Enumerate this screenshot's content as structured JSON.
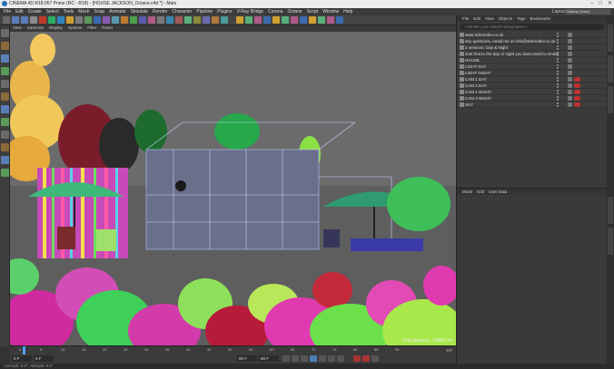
{
  "window": {
    "title": "CINEMA 4D R18.057 Prime (RC - R18) - [HOUSE JACKSON_Octane.c4d *] - Main",
    "controls": [
      "–",
      "□",
      "✕"
    ]
  },
  "menu": {
    "items": [
      "File",
      "Edit",
      "Create",
      "Select",
      "Tools",
      "Mesh",
      "Snap",
      "Animate",
      "Simulate",
      "Render",
      "Character",
      "Pipeline",
      "Plugins",
      "V-Ray Bridge",
      "Corona",
      "Octane",
      "Script",
      "Window",
      "Help"
    ],
    "layout_label": "Layout:",
    "layout_value": "Startup (User)"
  },
  "viewport": {
    "menu": [
      "View",
      "Cameras",
      "Display",
      "Options",
      "Filter",
      "Panel"
    ],
    "grid_spacing": "Grid Spacing : 10000 cm"
  },
  "timeline": {
    "ticks": [
      "0",
      "5",
      "10",
      "15",
      "20",
      "25",
      "30",
      "35",
      "40",
      "45",
      "50",
      "55",
      "60",
      "65",
      "70",
      "75",
      "80",
      "85",
      "90"
    ],
    "end_frame": "0 F"
  },
  "transport": {
    "current": "0 F",
    "min": "0 F",
    "max": "90 F",
    "end": "90 F"
  },
  "status": {
    "text": "Azimuth: 0.0°, Altitude: 0.0°"
  },
  "object_manager": {
    "menu": [
      "File",
      "Edit",
      "View",
      "Objects",
      "Tags",
      "Bookmarks"
    ],
    "search_placeholder": "<<Enter your search string here>>",
    "rows": [
      {
        "label": "www.3dremdev.co.uk"
      },
      {
        "label": "any questions, email me on info@3dremdev.co.uk"
      },
      {
        "label": "2 versions: Day & Night"
      },
      {
        "label": "Just freeze the day or night you dont need to render"
      },
      {
        "label": "HOUSE"
      },
      {
        "label": "LIGHT DAY"
      },
      {
        "label": "LIGHT NIGHT"
      },
      {
        "label": "CAM 1 DAY"
      },
      {
        "label": "CAM 2 DAY"
      },
      {
        "label": "CAM 1 NIGHT"
      },
      {
        "label": "CAM 2 NIGHT"
      },
      {
        "label": "SKY"
      }
    ]
  },
  "attributes": {
    "menu": [
      "Mode",
      "Edit",
      "User Data"
    ]
  }
}
